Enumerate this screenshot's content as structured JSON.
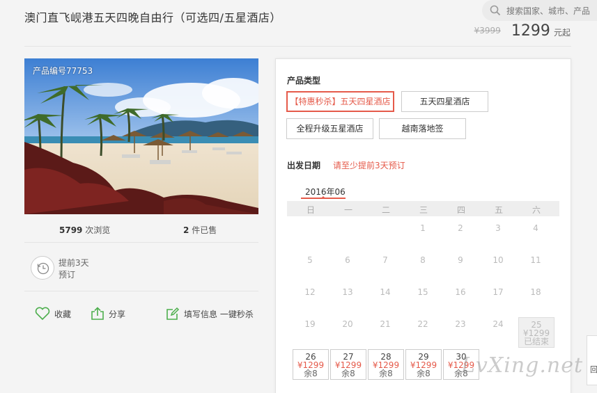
{
  "header": {
    "title": "澳门直飞岘港五天四晚自由行（可选四/五星酒店）",
    "search_placeholder": "搜索国家、城市、产品",
    "old_price": "¥3999",
    "price": "1299",
    "price_suffix": "元起"
  },
  "gallery": {
    "product_no": "产品编号77753"
  },
  "stats": {
    "views_count": "5799",
    "views_label": "次浏览",
    "sold_count": "2",
    "sold_label": "件已售"
  },
  "advance": {
    "line1": "提前3天",
    "line2": "预订"
  },
  "actions": {
    "favorite": "收藏",
    "share": "分享",
    "quick_buy": "填写信息 一键秒杀"
  },
  "booking": {
    "type_label": "产品类型",
    "options": [
      "【特惠秒杀】五天四星酒店",
      "五天四星酒店",
      "全程升级五星酒店",
      "越南落地签"
    ],
    "depart_label": "出发日期",
    "depart_note": "请至少提前3天预订"
  },
  "calendar": {
    "month": "2016年06",
    "weekdays": [
      "日",
      "一",
      "二",
      "三",
      "四",
      "五",
      "六"
    ],
    "plain_days": [
      "1",
      "2",
      "3",
      "4",
      "5",
      "6",
      "7",
      "8",
      "9",
      "10",
      "11",
      "12",
      "13",
      "14",
      "15",
      "16",
      "17",
      "18",
      "19",
      "20",
      "21",
      "22",
      "23",
      "24"
    ],
    "ended_day": {
      "day": "25",
      "price": "¥1299",
      "status": "已结束"
    },
    "available_days": [
      {
        "day": "26",
        "price": "¥1299",
        "remain": "余8"
      },
      {
        "day": "27",
        "price": "¥1299",
        "remain": "余8"
      },
      {
        "day": "28",
        "price": "¥1299",
        "remain": "余8"
      },
      {
        "day": "29",
        "price": "¥1299",
        "remain": "余8"
      },
      {
        "day": "30",
        "price": "¥1299",
        "remain": "余8"
      }
    ]
  },
  "watermark": "LvXing.net",
  "side_button": "回"
}
